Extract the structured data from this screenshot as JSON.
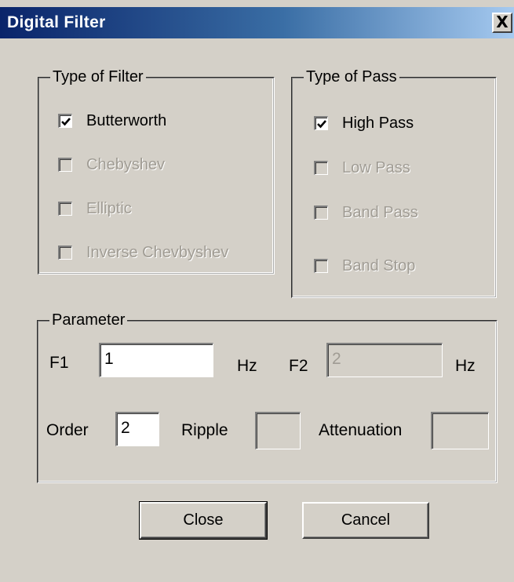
{
  "window": {
    "title": "Digital Filter",
    "close_glyph": "X"
  },
  "filter_type": {
    "legend": "Type of Filter",
    "options": [
      {
        "label": "Butterworth",
        "checked": true,
        "enabled": true
      },
      {
        "label": "Chebyshev",
        "checked": false,
        "enabled": false
      },
      {
        "label": "Elliptic",
        "checked": false,
        "enabled": false
      },
      {
        "label": "Inverse Chevbyshev",
        "checked": false,
        "enabled": false
      }
    ]
  },
  "pass_type": {
    "legend": "Type of Pass",
    "options": [
      {
        "label": "High Pass",
        "checked": true,
        "enabled": true
      },
      {
        "label": "Low Pass",
        "checked": false,
        "enabled": false
      },
      {
        "label": "Band Pass",
        "checked": false,
        "enabled": false
      },
      {
        "label": "Band Stop",
        "checked": false,
        "enabled": false
      }
    ]
  },
  "parameter": {
    "legend": "Parameter",
    "f1_label": "F1",
    "f1_value": "1",
    "f1_unit": "Hz",
    "f2_label": "F2",
    "f2_value": "2",
    "f2_unit": "Hz",
    "order_label": "Order",
    "order_value": "2",
    "ripple_label": "Ripple",
    "ripple_value": "",
    "attenuation_label": "Attenuation",
    "attenuation_value": ""
  },
  "buttons": {
    "close_label": "Close",
    "cancel_label": "Cancel"
  },
  "colors": {
    "dialog_face": "#d4d0c8",
    "title_start": "#0a246a",
    "title_end": "#a6caf0",
    "disabled_text": "#a09c94"
  }
}
